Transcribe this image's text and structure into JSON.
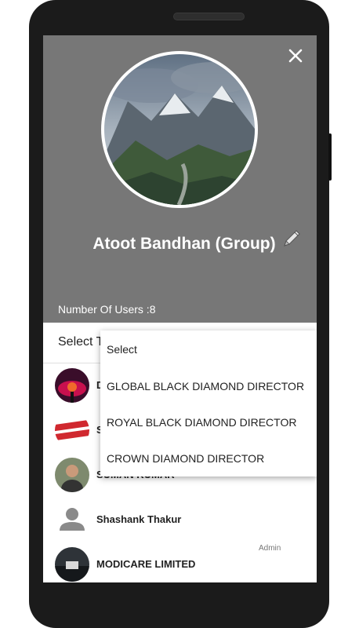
{
  "group": {
    "name": "Atoot Bandhan (Group)",
    "users_label": "Number Of Users :8"
  },
  "select": {
    "label": "Select T"
  },
  "dropdown": {
    "options": [
      "Select",
      "GLOBAL BLACK DIAMOND DIRECTOR",
      "ROYAL BLACK DIAMOND DIRECTOR",
      "CROWN DIAMOND DIRECTOR"
    ]
  },
  "members": [
    {
      "name": "D",
      "role": ""
    },
    {
      "name": "S",
      "role": ""
    },
    {
      "name": "SUMAN KUMAR",
      "role": ""
    },
    {
      "name": "Shashank Thakur",
      "role": ""
    },
    {
      "name": "MODICARE LIMITED",
      "role": "Admin"
    }
  ],
  "icons": {
    "close": "close-icon",
    "edit": "pencil-icon",
    "default_avatar": "person-icon"
  },
  "colors": {
    "header_bg": "#777777",
    "screen_bg": "#ffffff"
  }
}
